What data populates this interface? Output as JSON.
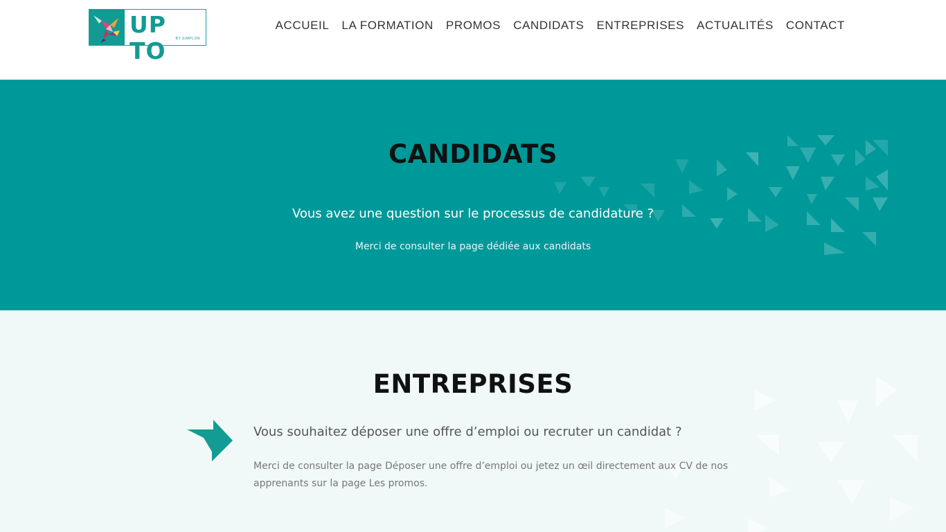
{
  "header": {
    "logo": {
      "text": "UP TO",
      "subtext": "BY SIMPLON"
    },
    "nav": [
      {
        "label": "ACCUEIL"
      },
      {
        "label": "LA FORMATION"
      },
      {
        "label": "PROMOS"
      },
      {
        "label": "CANDIDATS"
      },
      {
        "label": "ENTREPRISES"
      },
      {
        "label": "ACTUALITÉS"
      },
      {
        "label": "CONTACT"
      }
    ]
  },
  "candidats": {
    "title": "CANDIDATS",
    "question": "Vous avez une question sur le processus de candidature ?",
    "info": "Merci de consulter la page dédiée aux candidats"
  },
  "entreprises": {
    "title": "ENTREPRISES",
    "question": "Vous souhaitez déposer une offre d’emploi ou recruter un candidat ?",
    "info": "Merci de consulter la page Déposer une offre d’emploi ou jetez un œil directement aux CV de nos apprenants sur la page Les promos."
  },
  "colors": {
    "accent": "#00999a",
    "brand_teal": "#139b93",
    "light_band": "#f0f8f8",
    "nav_text": "#333333"
  },
  "icons": [
    "logo-bird-icon",
    "arrow-chevron-icon",
    "triangle-pattern-decoration"
  ]
}
